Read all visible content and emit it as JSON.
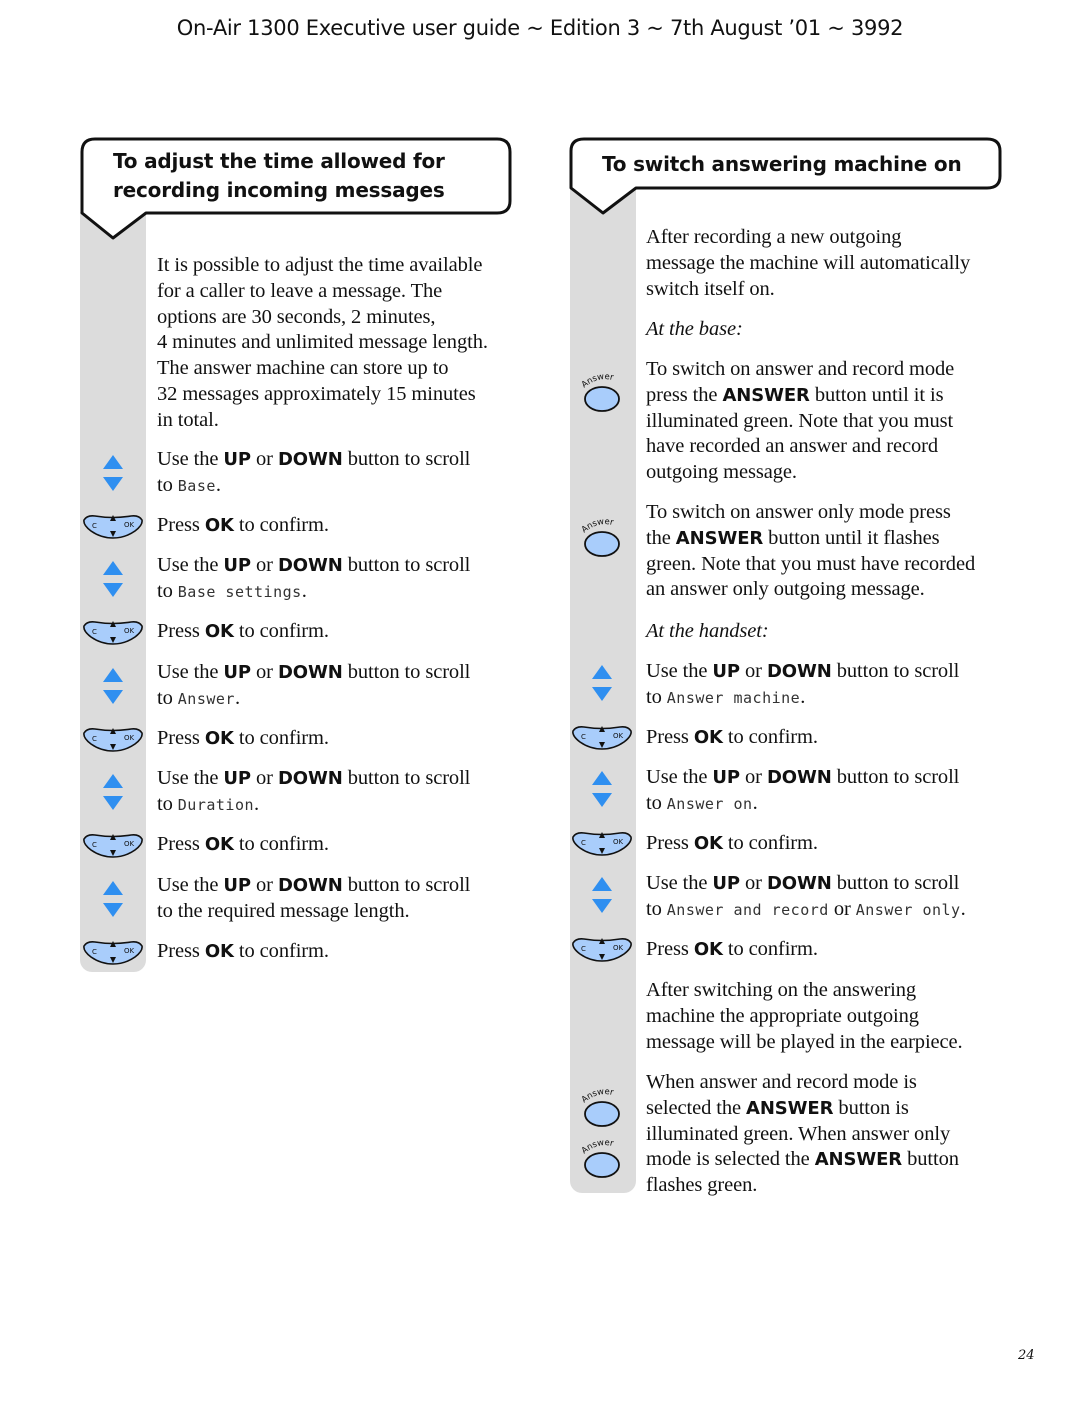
{
  "header": {
    "title": "On-Air 1300 Executive user guide ~ Edition 3 ~ 7th August ’01 ~ 3992"
  },
  "page_number": "24",
  "colors": {
    "sidebar": "#dcdcdc",
    "arrow_blue": "#2f8ff0",
    "button_fill": "#a9cdfb",
    "outline": "#111111"
  },
  "left_section": {
    "title_line1": "To adjust the time allowed for",
    "title_line2": "recording incoming messages",
    "intro": [
      "It is possible to adjust the time available",
      "for a caller to leave a message. The",
      "options are 30 seconds, 2 minutes,",
      "4 minutes and unlimited message length.",
      "The answer machine can store up to",
      "32 messages approximately 15 minutes",
      "in total."
    ],
    "steps": [
      {
        "icon": "up-down-arrows-icon",
        "pre": "Use the ",
        "k1": "UP",
        "mid": " or ",
        "k2": "DOWN",
        "post": " button to scroll",
        "line2_pre": "to ",
        "lcd": "Base",
        "line2_post": "."
      },
      {
        "icon": "ok-key-icon",
        "pre": "Press ",
        "k1": "OK",
        "post": " to confirm."
      },
      {
        "icon": "up-down-arrows-icon",
        "pre": "Use the ",
        "k1": "UP",
        "mid": " or ",
        "k2": "DOWN",
        "post": " button to scroll",
        "line2_pre": "to ",
        "lcd": "Base  settings",
        "line2_post": "."
      },
      {
        "icon": "ok-key-icon",
        "pre": "Press ",
        "k1": "OK",
        "post": " to confirm."
      },
      {
        "icon": "up-down-arrows-icon",
        "pre": "Use the ",
        "k1": "UP",
        "mid": " or ",
        "k2": "DOWN",
        "post": " button to scroll",
        "line2_pre": "to ",
        "lcd": "Answer",
        "line2_post": "."
      },
      {
        "icon": "ok-key-icon",
        "pre": "Press ",
        "k1": "OK",
        "post": " to confirm."
      },
      {
        "icon": "up-down-arrows-icon",
        "pre": "Use the ",
        "k1": "UP",
        "mid": " or ",
        "k2": "DOWN",
        "post": " button to scroll",
        "line2_pre": "to ",
        "lcd": "Duration",
        "line2_post": "."
      },
      {
        "icon": "ok-key-icon",
        "pre": "Press ",
        "k1": "OK",
        "post": " to confirm."
      },
      {
        "icon": "up-down-arrows-icon",
        "pre": "Use  the ",
        "k1": "UP",
        "mid": " or ",
        "k2": "DOWN",
        "post": " button to scroll",
        "line2_pre": "to the required message length.",
        "lcd": "",
        "line2_post": ""
      },
      {
        "icon": "ok-key-icon",
        "pre": "Press ",
        "k1": "OK",
        "post": " to confirm."
      }
    ]
  },
  "right_section": {
    "title": "To switch answering machine on",
    "intro": [
      "After recording a new outgoing",
      "message the machine will automatically",
      "switch itself on."
    ],
    "at_base_label": "At the base:",
    "base_para1": {
      "l1": "To switch on answer and record mode",
      "l2_pre": "press the ",
      "l2_kw": "ANSWER",
      "l2_post": " button until it is",
      "l3": "illuminated green. Note that you must",
      "l4": "have recorded an answer and record",
      "l5": "outgoing message."
    },
    "base_para2": {
      "l1": "To switch on answer only mode press",
      "l2_pre": "the ",
      "l2_kw": "ANSWER",
      "l2_post": " button until it flashes",
      "l3": "green. Note that you must have recorded",
      "l4": "an answer only outgoing message."
    },
    "at_handset_label": "At the handset:",
    "steps": [
      {
        "pre": "Use the ",
        "k1": "UP",
        "mid": " or ",
        "k2": "DOWN",
        "post": " button to scroll",
        "line2_pre": "to ",
        "lcd": "Answer  machine",
        "line2_post": "."
      },
      {
        "pre": "Press ",
        "k1": "OK",
        "post": " to confirm."
      },
      {
        "pre": "Use the ",
        "k1": "UP",
        "mid": " or ",
        "k2": "DOWN",
        "post": " button to scroll",
        "line2_pre": "to ",
        "lcd": "Answer on",
        "line2_post": "."
      },
      {
        "pre": "Press ",
        "k1": "OK",
        "post": " to confirm."
      },
      {
        "pre": "Use the ",
        "k1": "UP",
        "mid": " or ",
        "k2": "DOWN",
        "post": " button to scroll",
        "line2_pre": "to ",
        "lcd": "Answer and record",
        "line2_mid": " or ",
        "lcd2": "Answer only",
        "line2_post": "."
      },
      {
        "pre": "Press ",
        "k1": "OK",
        "post": " to confirm."
      }
    ],
    "after_switch": [
      "After switching on the answering",
      "machine the appropriate outgoing",
      "message will be played in the earpiece."
    ],
    "final_para": {
      "l1": "When answer and record mode is",
      "l2_pre": "selected the ",
      "l2_kw": "ANSWER",
      "l2_post": " button is",
      "l3": "illuminated green. When answer only",
      "l4_pre": "mode is selected the ",
      "l4_kw": "ANSWER",
      "l4_post": " button",
      "l5": "flashes green."
    },
    "answer_button_label": "Answer"
  }
}
